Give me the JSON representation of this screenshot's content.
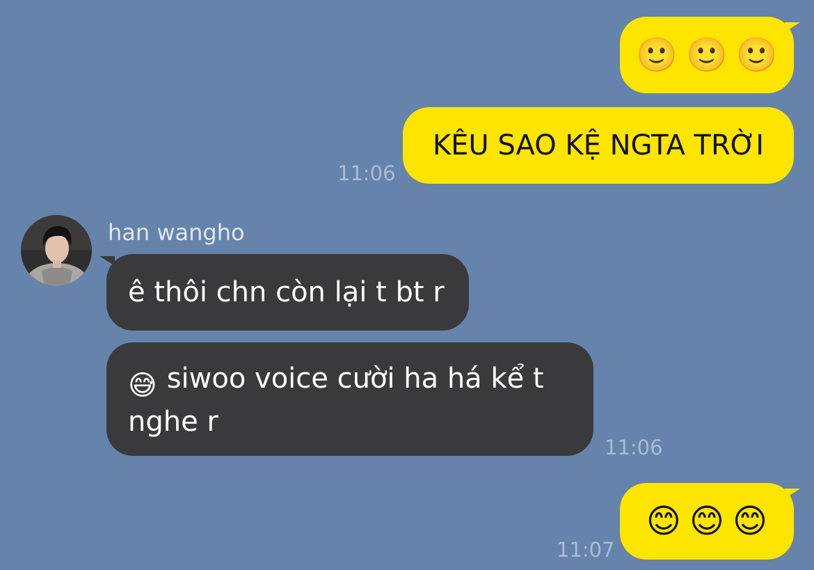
{
  "messages": [
    {
      "direction": "outgoing",
      "text": "🙂🙂🙂",
      "emojis": [
        "🙂",
        "🙂",
        "🙂"
      ],
      "emoji_names": [
        "slightly-smiling-face",
        "slightly-smiling-face",
        "slightly-smiling-face"
      ]
    },
    {
      "direction": "outgoing",
      "text": "KÊU SAO KỆ NGTA TRỜI",
      "time": "11:06"
    },
    {
      "direction": "incoming",
      "sender": "han wangho",
      "text": "ê thôi chn còn lại t bt r"
    },
    {
      "direction": "incoming",
      "emoji": "😅",
      "emoji_name": "grinning-sweat-face",
      "line1": "siwoo voice cười ha há kể t",
      "line2": "nghe r",
      "time": "11:06"
    },
    {
      "direction": "outgoing",
      "text": "😊😊😊",
      "emojis": [
        "😊",
        "😊",
        "😊"
      ],
      "emoji_names": [
        "smiling-face-with-smiling-eyes",
        "smiling-face-with-smiling-eyes",
        "smiling-face-with-smiling-eyes"
      ],
      "time": "11:07"
    }
  ],
  "contact": {
    "name": "han wangho",
    "avatar": "profile-photo"
  },
  "colors": {
    "background": "#6683ab",
    "outgoing_bubble": "#fee500",
    "incoming_bubble": "#3a3a3c",
    "timestamp": "#a9bcd6"
  }
}
